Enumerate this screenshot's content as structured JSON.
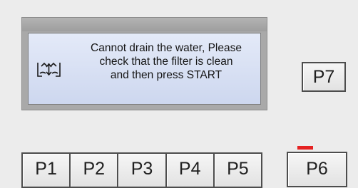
{
  "display": {
    "message_lines": [
      "Cannot drain the water, Please",
      "check that the filter is clean",
      "and then press START"
    ],
    "icon": "drain-filter-icon"
  },
  "keys": {
    "row": [
      "P1",
      "P2",
      "P3",
      "P4",
      "P5"
    ],
    "p6": "P6",
    "p7": "P7"
  },
  "indicator": {
    "color": "#e52222"
  }
}
